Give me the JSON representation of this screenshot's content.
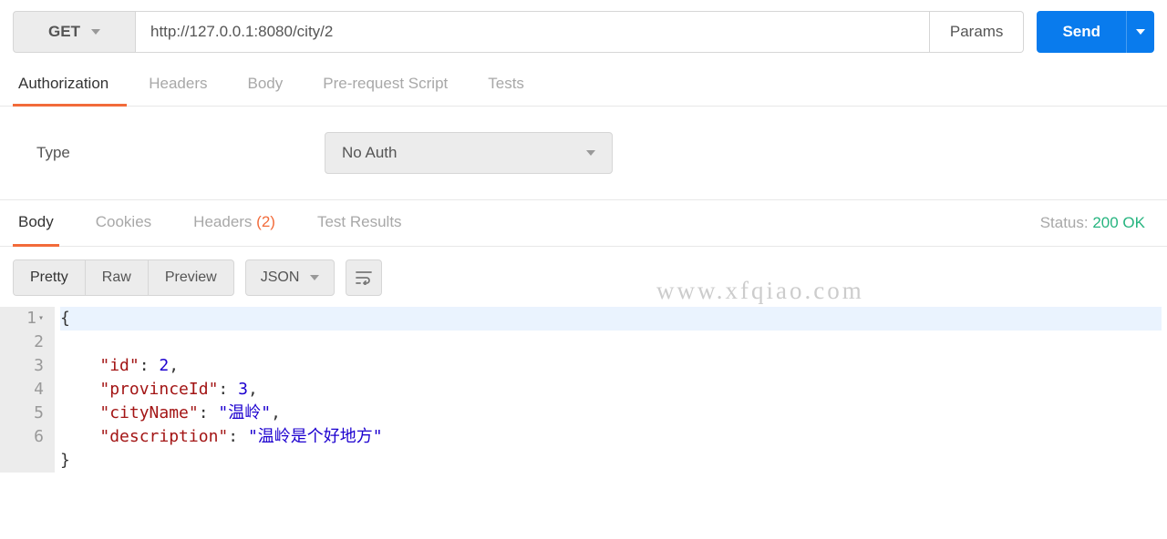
{
  "request": {
    "method": "GET",
    "url": "http://127.0.0.1:8080/city/2",
    "params_label": "Params",
    "send_label": "Send"
  },
  "req_tabs": {
    "authorization": "Authorization",
    "headers": "Headers",
    "body": "Body",
    "pre_request": "Pre-request Script",
    "tests": "Tests"
  },
  "auth": {
    "type_label": "Type",
    "selected": "No Auth"
  },
  "resp_tabs": {
    "body": "Body",
    "cookies": "Cookies",
    "headers": "Headers",
    "headers_count": "(2)",
    "test_results": "Test Results"
  },
  "status": {
    "label": "Status:",
    "value": "200 OK"
  },
  "toolbar": {
    "pretty": "Pretty",
    "raw": "Raw",
    "preview": "Preview",
    "format": "JSON"
  },
  "code_lines": [
    "1",
    "2",
    "3",
    "4",
    "5",
    "6"
  ],
  "response_body": {
    "id": 2,
    "provinceId": 3,
    "cityName": "温岭",
    "description": "温岭是个好地方"
  },
  "watermark": "www.xfqiao.com"
}
